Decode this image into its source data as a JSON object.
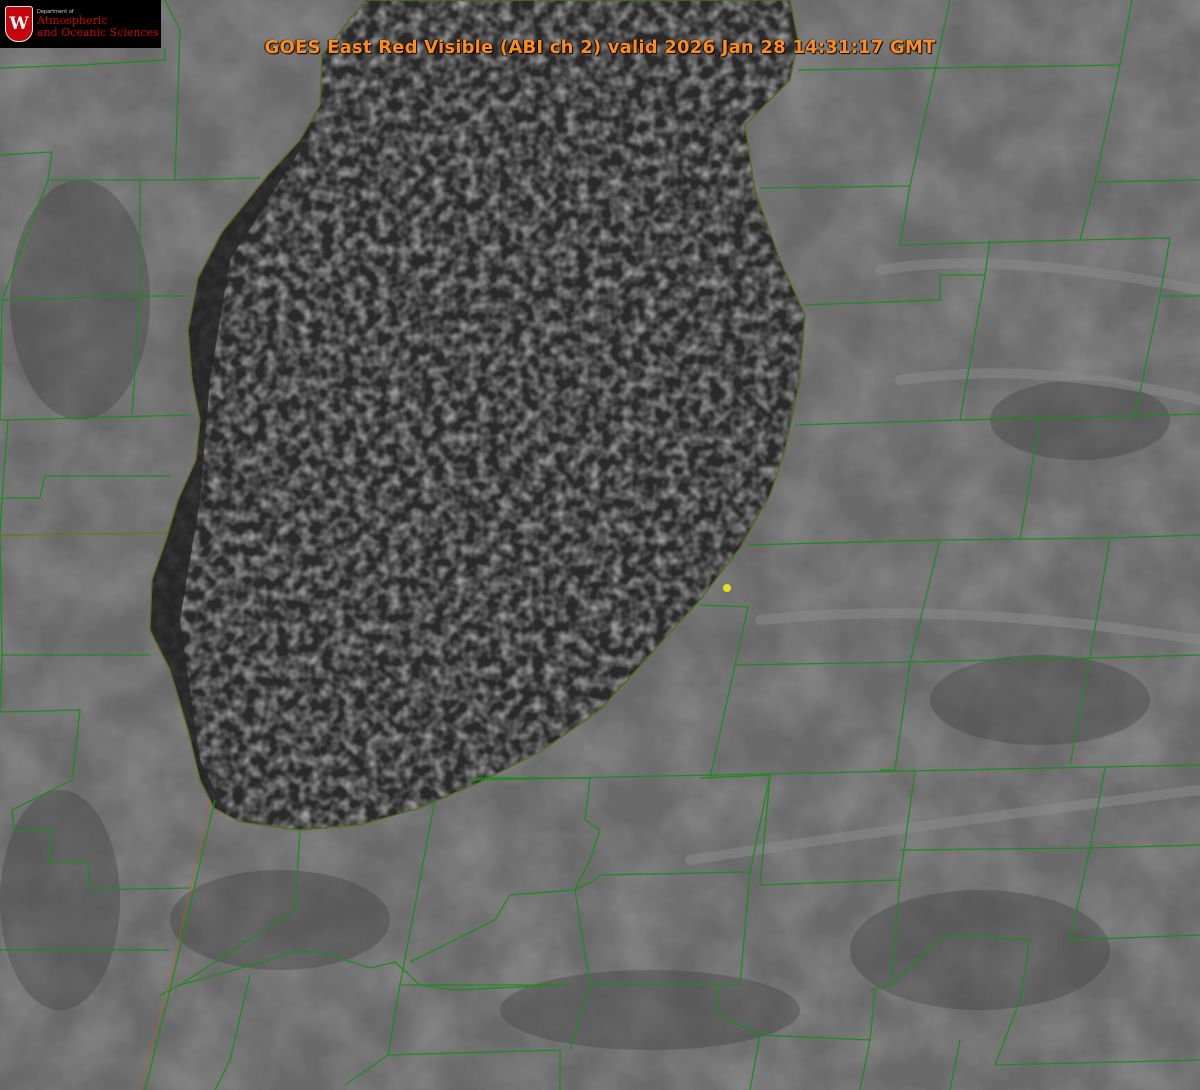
{
  "title": "GOES East Red Visible (ABI ch 2) valid 2026 Jan 28 14:31:17 GMT",
  "logo": {
    "glyph": "W",
    "dept": "Department of",
    "line1": "Atmospheric",
    "line2": "and Oceanic Sciences"
  },
  "colors": {
    "land": "#6a6a6a",
    "lake": "#2a2a2a",
    "county_lines": "#1f8a1f",
    "shoreline": "#e02020",
    "title_text": "#ff8c1a",
    "marker": "#e6e020"
  },
  "map": {
    "imagery": "satellite visible channel",
    "features": [
      "lake",
      "lake-effect cloud field",
      "county boundaries",
      "shoreline",
      "station marker"
    ]
  }
}
